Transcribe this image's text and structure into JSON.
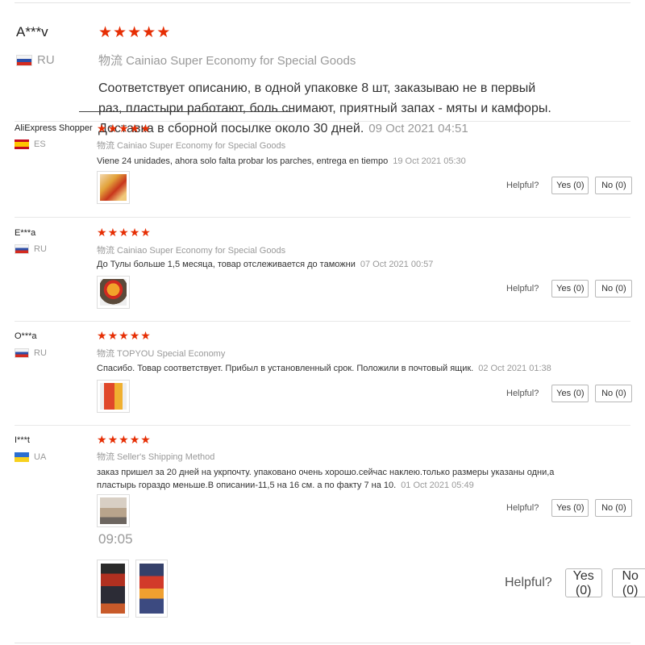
{
  "reviews": [
    {
      "author": "A***v",
      "country": "RU",
      "logistics": "物流 Cainiao Super Economy for Special Goods",
      "text": "Соответствует описанию, в одной упаковке 8 шт, заказываю не в первый раз, пластыри работают, боль снимают, приятный запах - мяты и камфоры. Доставка в сборной посылке около 30 дней.",
      "date": "09 Oct 2021 04:51"
    },
    {
      "author": "AliExpress Shopper",
      "country": "ES",
      "logistics": "物流 Cainiao Super Economy for Special Goods",
      "text": "Viene 24 unidades, ahora solo falta probar los parches, entrega en tiempo",
      "date": "19 Oct 2021 05:30"
    },
    {
      "author": "E***a",
      "country": "RU",
      "logistics": "物流 Cainiao Super Economy for Special Goods",
      "text": "До Тулы больше 1,5 месяца, товар отслеживается до таможни",
      "date": "07 Oct 2021 00:57"
    },
    {
      "author": "O***a",
      "country": "RU",
      "logistics": "物流 TOPYOU Special Economy",
      "text": "Спасибо. Товар соответствует. Прибыл в установленный срок. Положили в почтовый ящик.",
      "date": "02 Oct 2021 01:38"
    },
    {
      "author": "I***t",
      "country": "UA",
      "logistics": "物流 Seller's Shipping Method",
      "text": "заказ пришел за 20 дней на укрпочту. упаковано очень хорошо.сейчас наклею.только размеры указаны одни,а пластырь гораздо меньше.В описании-11,5 на 16 см. а по факту 7 на 10.",
      "date": "01 Oct 2021 05:49"
    }
  ],
  "helpful": {
    "label": "Helpful?",
    "yes": "Yes (0)",
    "no": "No (0)"
  },
  "fragment": {
    "time": "09:05"
  },
  "colors": {
    "star": "#e62e04",
    "muted": "#999999",
    "divider": "#e8e8e8"
  }
}
